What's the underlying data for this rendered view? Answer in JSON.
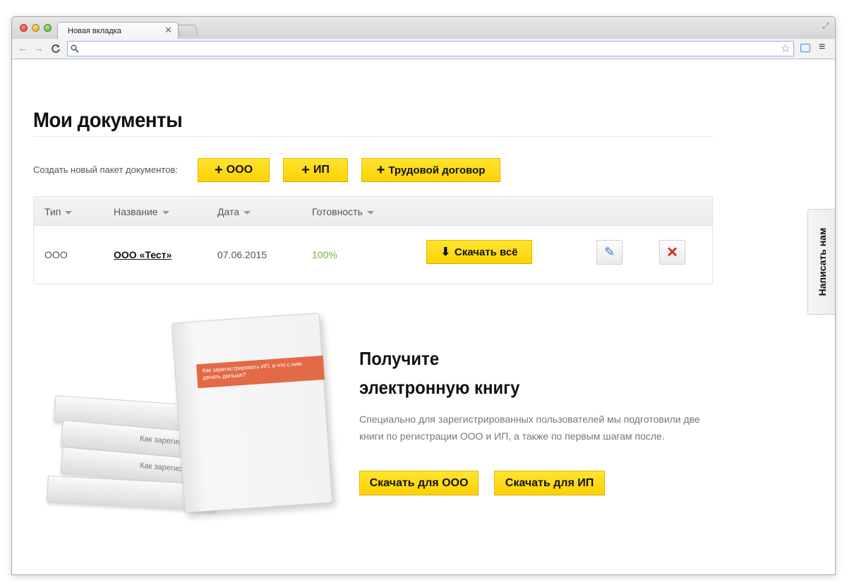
{
  "browser": {
    "tab_title": "Новая вкладка",
    "tab_close": "×",
    "address_value": "",
    "address_placeholder": ""
  },
  "icons": {
    "back": "←",
    "forward": "→",
    "reload": "C",
    "search": "⚲",
    "star": "☆",
    "menu": "≡",
    "fullscreen": "⤢",
    "plus": "+",
    "download": "⬇",
    "edit": "✎",
    "delete": "✕"
  },
  "page": {
    "title": "Мои документы",
    "create_label": "Создать новый пакет документов:",
    "create_buttons": {
      "ooo": "ООО",
      "ip": "ИП",
      "labor": "Трудовой договор"
    }
  },
  "table": {
    "headers": {
      "type": "Тип",
      "name": "Название",
      "date": "Дата",
      "ready": "Готовность"
    },
    "rows": [
      {
        "type": "ООО",
        "name": "ООО «Тест»",
        "date": "07.06.2015",
        "ready": "100%",
        "download_label": "Скачать всё"
      }
    ]
  },
  "promo": {
    "title_line1": "Получите",
    "title_line2": "электронную книгу",
    "text": "Специально для зарегистрированных пользователей мы подготовили две книги по регистрации ООО и ИП, а также по первым шагам после.",
    "btn_ooo": "Скачать для ООО",
    "btn_ip": "Скачать для ИП",
    "book_title": "Как зарегистрировать ИП, и что с ним делать дальше?",
    "book_stack_label": "Как зарегистрировать"
  },
  "feedback": {
    "label": "Написать нам"
  },
  "colors": {
    "accent_yellow": "#ffd200",
    "ready_green": "#6db23f",
    "delete_red": "#e02020",
    "edit_blue": "#2f7ad1",
    "book_band": "#e26a45"
  }
}
